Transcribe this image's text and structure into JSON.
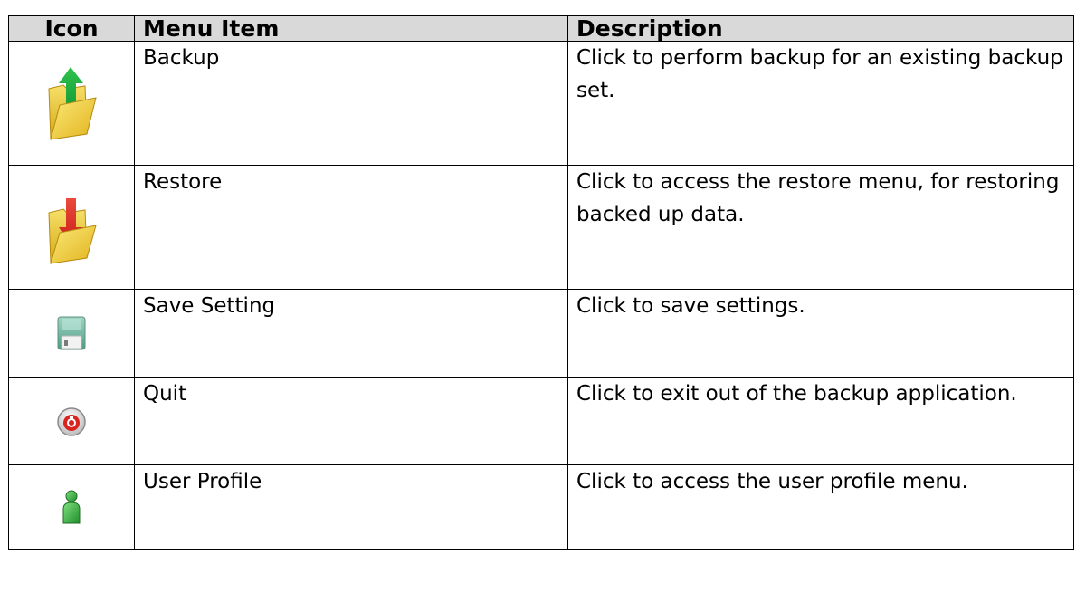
{
  "headers": {
    "icon": "Icon",
    "item": "Menu Item",
    "description": "Description"
  },
  "rows": [
    {
      "icon": "folder-upload-icon",
      "item": "Backup",
      "description": "Click to perform backup for an existing backup set."
    },
    {
      "icon": "folder-download-icon",
      "item": "Restore",
      "description": "Click to access the restore menu, for restoring backed up data."
    },
    {
      "icon": "floppy-disk-icon",
      "item": "Save Setting",
      "description": "Click to save settings."
    },
    {
      "icon": "power-icon",
      "item": "Quit",
      "description": "Click to exit out of the backup application."
    },
    {
      "icon": "user-icon",
      "item": "User Profile",
      "description": "Click to access the user profile menu."
    }
  ],
  "colors": {
    "header_bg": "#d9d9d9",
    "border": "#000000",
    "folder": "#e8c42a",
    "upload_arrow": "#18a23a",
    "download_arrow": "#d42a20",
    "power_red": "#d8231f",
    "user_green": "#3cb43c"
  }
}
